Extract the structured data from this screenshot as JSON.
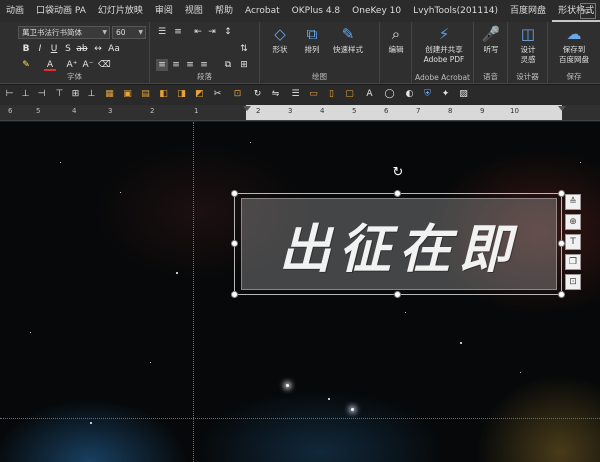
{
  "tabs": [
    "动画",
    "口袋动画 PA",
    "幻灯片放映",
    "审阅",
    "视图",
    "帮助",
    "Acrobat",
    "OKPlus 4.8",
    "OneKey 10",
    "LvyhTools(201114)",
    "百度网盘",
    "形状格式"
  ],
  "active_tab": "形状格式",
  "window": {
    "restore_icon": "ribbon-display-icon",
    "symbol": "▭"
  },
  "font": {
    "name": "萬卫书法行书简体",
    "size": "60",
    "group_label": "字体"
  },
  "paragraph": {
    "group_label": "段落"
  },
  "drawing": {
    "group_label": "绘图",
    "buttons": [
      {
        "label": "形状",
        "icon": "shapes-icon",
        "glyph": "◇"
      },
      {
        "label": "排列",
        "icon": "arrange-icon",
        "glyph": "⧉"
      },
      {
        "label": "快速样式",
        "icon": "quick-styles-icon",
        "glyph": "✎"
      }
    ]
  },
  "editing": {
    "label": "编辑",
    "icon": "search-icon",
    "glyph": "⌕"
  },
  "adobe": {
    "button_label_1": "创建并共享",
    "button_label_2": "Adobe PDF",
    "group_label": "Adobe Acrobat",
    "glyph": "⚡"
  },
  "voice": {
    "button_label": "听写",
    "group_label": "语音",
    "glyph": "🎤"
  },
  "designer": {
    "button_label_1": "设计",
    "button_label_2": "灵感",
    "group_label": "设计器",
    "glyph": "◫"
  },
  "save": {
    "button_label_1": "保存到",
    "button_label_2": "百度网盘",
    "group_label": "保存",
    "glyph": "☁"
  },
  "ruler": {
    "labels": [
      "6",
      "5",
      "4",
      "3",
      "2",
      "1",
      "2",
      "3",
      "4",
      "5",
      "6",
      "7",
      "8",
      "9",
      "10"
    ]
  },
  "slide": {
    "text": "出征在即"
  },
  "side_tools": [
    "layout-options-icon",
    "format-icon",
    "text-icon",
    "copy-icon",
    "crop-icon"
  ],
  "side_tool_glyphs": [
    "≙",
    "⊕",
    "T",
    "❐",
    "⊡"
  ],
  "rotate_glyph": "↻"
}
